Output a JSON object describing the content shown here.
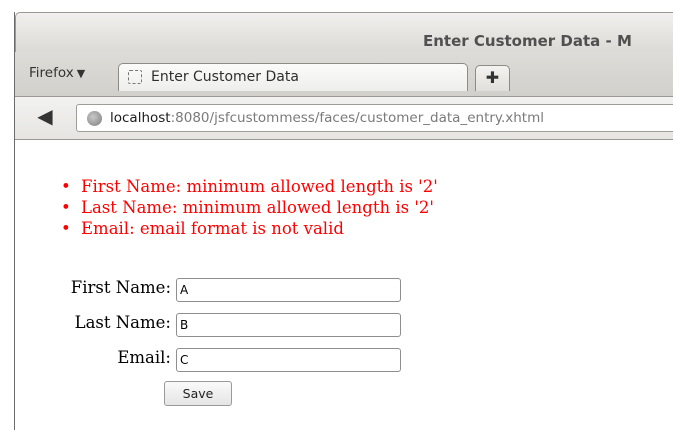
{
  "window": {
    "title": "Enter Customer Data - M"
  },
  "menu": {
    "firefox_label": "Firefox",
    "firefox_arrow": "▼"
  },
  "tabs": [
    {
      "label": "Enter Customer Data",
      "active": true
    }
  ],
  "new_tab": {
    "icon": "plus-icon",
    "glyph": "✚"
  },
  "navigation": {
    "back_icon": "back-arrow-icon",
    "back_glyph": "◀"
  },
  "address": {
    "host": "localhost",
    "rest": ":8080/jsfcustommess/faces/customer_data_entry.xhtml"
  },
  "messages": [
    "First Name: minimum allowed length is '2'",
    "Last Name: minimum allowed length is '2'",
    "Email: email format is not valid"
  ],
  "form": {
    "first_name": {
      "label": "First Name:",
      "value": "A"
    },
    "last_name": {
      "label": "Last Name:",
      "value": "B"
    },
    "email": {
      "label": "Email:",
      "value": "C"
    },
    "save_label": "Save"
  },
  "colors": {
    "error": "#ff0000",
    "chrome": "#dcdad6"
  }
}
